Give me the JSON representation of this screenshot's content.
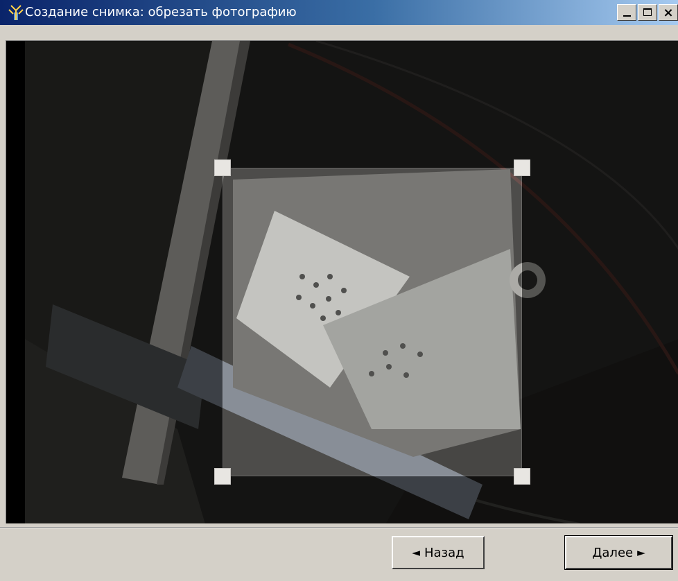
{
  "window": {
    "title": "Создание снимка: обрезать фотографию",
    "icon": "app-antenna-icon",
    "title_gradient": [
      "#0a246a",
      "#a6caf0"
    ],
    "controls": {
      "minimize_icon": "minimize-icon",
      "maximize_icon": "maximize-icon",
      "close_icon": "close-icon",
      "close_glyph": "×"
    }
  },
  "photo": {
    "description_icon": "camera-photo",
    "crop_handles": [
      "top-left",
      "top-right",
      "bottom-left",
      "bottom-right"
    ]
  },
  "buttons": {
    "back": {
      "label": "Назад",
      "arrow": "◄"
    },
    "next": {
      "label": "Далее",
      "arrow": "►"
    }
  },
  "colors": {
    "face": "#d4d0c8",
    "photo_dim": "#1a1918",
    "crop_highlight": "#e8e6e2"
  }
}
